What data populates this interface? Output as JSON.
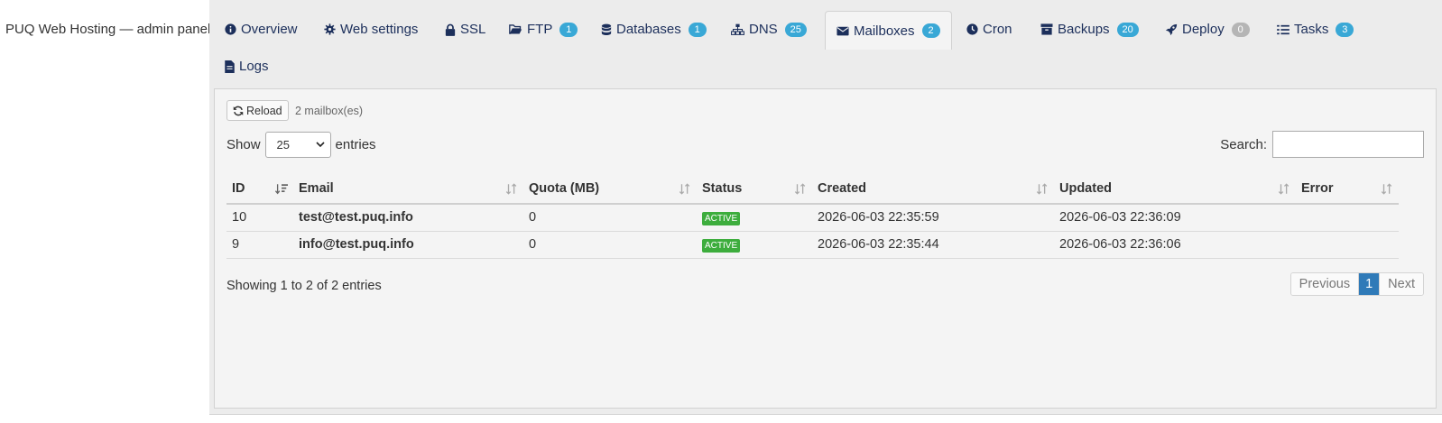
{
  "app": {
    "title": "PUQ Web Hosting — admin panel"
  },
  "tabs": [
    {
      "label": "Overview",
      "icon": "info-circle-icon"
    },
    {
      "label": "Web settings",
      "icon": "gear-icon"
    },
    {
      "label": "SSL",
      "icon": "lock-icon"
    },
    {
      "label": "FTP",
      "icon": "folder-open-icon",
      "badge": "1"
    },
    {
      "label": "Databases",
      "icon": "database-icon",
      "badge": "1"
    },
    {
      "label": "DNS",
      "icon": "sitemap-icon",
      "badge": "25"
    },
    {
      "label": "Mailboxes",
      "icon": "envelope-icon",
      "badge": "2",
      "active": true
    },
    {
      "label": "Cron",
      "icon": "clock-icon"
    },
    {
      "label": "Backups",
      "icon": "archive-icon",
      "badge": "20"
    },
    {
      "label": "Deploy",
      "icon": "rocket-icon",
      "badge": "0"
    },
    {
      "label": "Tasks",
      "icon": "list-icon",
      "badge": "3"
    },
    {
      "label": "Logs",
      "icon": "file-icon"
    }
  ],
  "toolbar": {
    "reload_label": "Reload",
    "count_text": "2 mailbox(es)"
  },
  "length": {
    "show_label": "Show",
    "selected": "25",
    "entries_label": "entries"
  },
  "search": {
    "label": "Search:",
    "value": ""
  },
  "table": {
    "columns": [
      "ID",
      "Email",
      "Quota (MB)",
      "Status",
      "Created",
      "Updated",
      "Error"
    ],
    "rows": [
      {
        "id": "10",
        "email": "test@test.puq.info",
        "quota": "0",
        "status": "ACTIVE",
        "created": "2026-06-03 22:35:59",
        "updated": "2026-06-03 22:36:09",
        "error": ""
      },
      {
        "id": "9",
        "email": "info@test.puq.info",
        "quota": "0",
        "status": "ACTIVE",
        "created": "2026-06-03 22:35:44",
        "updated": "2026-06-03 22:36:06",
        "error": ""
      }
    ]
  },
  "footer": {
    "info": "Showing 1 to 2 of 2 entries",
    "prev_label": "Previous",
    "page": "1",
    "next_label": "Next"
  },
  "colors": {
    "accent": "#1c2f5b",
    "badge": "#39a8d6",
    "badge_zero": "#b5b5b5",
    "status_active": "#3dad3d",
    "pager_active": "#2f7ab8"
  }
}
